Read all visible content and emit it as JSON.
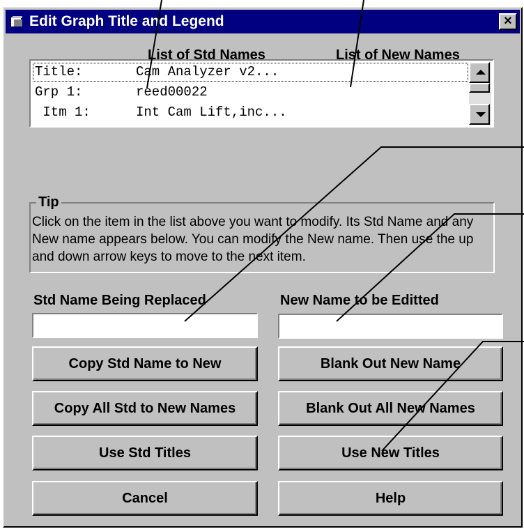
{
  "window": {
    "title": "Edit Graph Title and Legend",
    "close_glyph": "×",
    "close_icon": "close-icon",
    "app_icon": "window-app-icon"
  },
  "list_headers": {
    "std": "List of Std Names",
    "new": "List of New Names"
  },
  "list": {
    "items": [
      {
        "prefix": "Title:",
        "std": "Cam Analyzer v2..."
      },
      {
        "prefix": "Grp 1:",
        "std": "reed00022"
      },
      {
        "prefix": " Itm 1:",
        "std": "Int Cam Lift,inc..."
      }
    ],
    "selected_index": 0
  },
  "tip": {
    "legend": "Tip",
    "text": "Click on the item in the list above you want to modify.  Its Std Name and any New name appears below.  You can modify the New name. Then use the up and down arrow keys to move to the next item."
  },
  "fields": {
    "std_label": "Std Name Being Replaced",
    "std_value": "",
    "new_label": "New Name to be Editted",
    "new_value": ""
  },
  "buttons": {
    "copy_std_to_new": "Copy Std Name to New",
    "blank_out_new": "Blank Out New Name",
    "copy_all_std": "Copy All Std to New Names",
    "blank_out_all": "Blank Out All New Names",
    "use_std_titles": "Use Std Titles",
    "use_new_titles": "Use New Titles",
    "cancel": "Cancel",
    "help": "Help"
  },
  "colors": {
    "titlebar": "#000080",
    "face": "#c0c0c0",
    "background": "#ffffff"
  }
}
